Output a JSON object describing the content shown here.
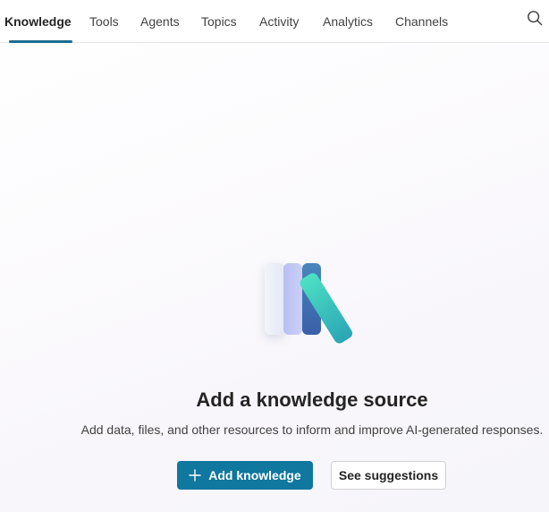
{
  "nav": {
    "tabs": [
      {
        "label": "Knowledge",
        "active": true
      },
      {
        "label": "Tools",
        "active": false
      },
      {
        "label": "Agents",
        "active": false
      },
      {
        "label": "Topics",
        "active": false
      },
      {
        "label": "Activity",
        "active": false
      },
      {
        "label": "Analytics",
        "active": false
      },
      {
        "label": "Channels",
        "active": false
      }
    ],
    "search_icon": "search-icon"
  },
  "empty_state": {
    "illustration_icon": "books-icon",
    "title": "Add a knowledge source",
    "description": "Add data, files, and other resources to inform and improve AI-generated responses.",
    "primary_button": {
      "label": "Add knowledge",
      "icon": "plus-icon"
    },
    "secondary_button": {
      "label": "See suggestions"
    }
  },
  "colors": {
    "accent": "#10779f",
    "tab_underline": "#1b6c91",
    "book_1": "#eef1f8",
    "book_2": "#c3c9f5",
    "book_3": "#3d70b0",
    "book_4": "#3ec6bd"
  }
}
